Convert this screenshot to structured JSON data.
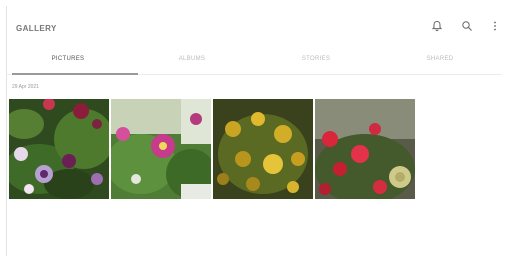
{
  "header": {
    "title": "GALLERY",
    "actions": [
      {
        "name": "notification-bell-icon"
      },
      {
        "name": "search-icon"
      },
      {
        "name": "more-options-icon"
      }
    ]
  },
  "tabs": [
    {
      "label": "PICTURES",
      "active": true
    },
    {
      "label": "ALBUMS",
      "active": false
    },
    {
      "label": "STORIES",
      "active": false
    },
    {
      "label": "SHARED",
      "active": false
    }
  ],
  "section": {
    "label": "29 Apr 2021"
  },
  "photos": [
    {
      "subject": "purple and red columbine flowers"
    },
    {
      "subject": "pink flowers in garden"
    },
    {
      "subject": "yellow flowering shrub"
    },
    {
      "subject": "red cyclamen flowers"
    }
  ],
  "colors": {
    "accent": "#9a9a9a",
    "background": "#ffffff"
  }
}
